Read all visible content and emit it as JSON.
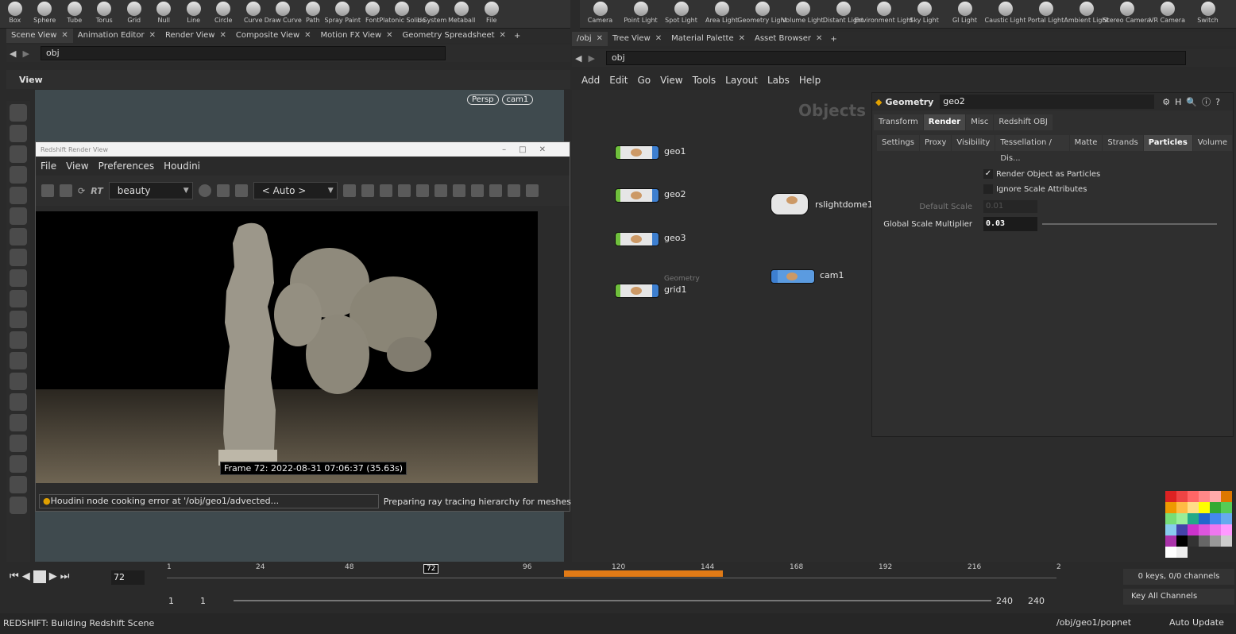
{
  "shelf_left": [
    "Box",
    "Sphere",
    "Tube",
    "Torus",
    "Grid",
    "Null",
    "Line",
    "Circle",
    "Curve",
    "Draw Curve",
    "Path",
    "Spray Paint",
    "Font",
    "Platonic Solids",
    "L-System",
    "Metaball",
    "File"
  ],
  "shelf_right": [
    "Camera",
    "Point Light",
    "Spot Light",
    "Area Light",
    "Geometry Light",
    "Volume Light",
    "Distant Light",
    "Environment Light",
    "Sky Light",
    "GI Light",
    "Caustic Light",
    "Portal Light",
    "Ambient Light",
    "Stereo Camera",
    "VR Camera",
    "Switch"
  ],
  "left_tabs": [
    "Scene View",
    "Animation Editor",
    "Render View",
    "Composite View",
    "Motion FX View",
    "Geometry Spreadsheet"
  ],
  "left_path": "obj",
  "viewer": {
    "title": "View",
    "persp": "Persp",
    "cam": "cam1"
  },
  "render_window": {
    "title": "Redshift Render View",
    "menu": [
      "File",
      "View",
      "Preferences",
      "Houdini"
    ],
    "rt_label": "RT",
    "aov": "beauty",
    "auto": "< Auto >",
    "frame_label": "Frame 72:  2022-08-31  07:06:37  (35.63s)",
    "error_text": "Houdini node cooking error at '/obj/geo1/advected...",
    "prep_text": "Preparing ray tracing hierarchy for meshes"
  },
  "right_tabs": [
    "/obj",
    "Tree View",
    "Material Palette",
    "Asset Browser"
  ],
  "right_path": "obj",
  "net_menu": [
    "Add",
    "Edit",
    "Go",
    "View",
    "Tools",
    "Layout",
    "Labs",
    "Help"
  ],
  "network": {
    "watermark": "Objects",
    "nodes": [
      {
        "label": "geo1",
        "sub": ""
      },
      {
        "label": "geo2",
        "sub": ""
      },
      {
        "label": "geo3",
        "sub": ""
      },
      {
        "label": "grid1",
        "sub": "Geometry"
      },
      {
        "label": "rslightdome1",
        "sub": ""
      },
      {
        "label": "cam1",
        "sub": ""
      }
    ]
  },
  "params": {
    "type": "Geometry",
    "node_name": "geo2",
    "tabs": [
      "Transform",
      "Render",
      "Misc",
      "Redshift OBJ"
    ],
    "subtabs": [
      "Settings",
      "Proxy",
      "Visibility",
      "Tessellation / Dis...",
      "Matte",
      "Strands",
      "Particles",
      "Volume"
    ],
    "render_as_particles": "Render Object as Particles",
    "ignore_scale": "Ignore Scale Attributes",
    "default_scale_label": "Default Scale",
    "default_scale_value": "0.01",
    "global_scale_label": "Global Scale Multiplier",
    "global_scale_value": "0.03"
  },
  "timeline": {
    "current_frame": "72",
    "ticks": [
      "1",
      "24",
      "48",
      "72",
      "96",
      "120",
      "144",
      "168",
      "192",
      "216",
      "2"
    ],
    "start": "1",
    "start2": "1",
    "end": "240",
    "end2": "240",
    "keys_info": "0 keys, 0/0 channels",
    "key_all": "Key All Channels"
  },
  "status": {
    "message": "REDSHIFT: Building Redshift Scene",
    "path": "/obj/geo1/popnet",
    "update": "Auto Update"
  },
  "colors": {
    "accent": "#e07a16",
    "panel": "#2c2c2c"
  }
}
